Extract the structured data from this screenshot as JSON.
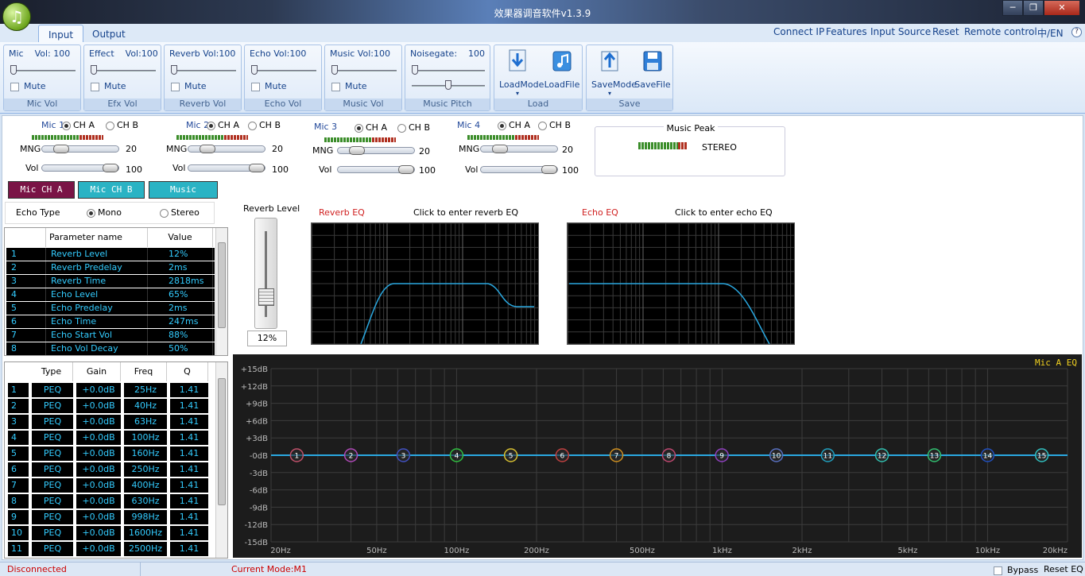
{
  "window": {
    "title": "效果器调音软件v1.3.9"
  },
  "tabs": [
    {
      "label": "Input"
    },
    {
      "label": "Output"
    }
  ],
  "top_links": [
    {
      "label": "Connect IP"
    },
    {
      "label": "Features"
    },
    {
      "label": "Input Source"
    },
    {
      "label": "Reset"
    },
    {
      "label": "Remote control"
    },
    {
      "label": "中/EN"
    }
  ],
  "ribbon": {
    "mic": {
      "label": "Mic    Vol: 100",
      "mute": "Mute",
      "group": "Mic Vol"
    },
    "efx": {
      "label": "Effect    Vol:100",
      "mute": "Mute",
      "group": "Efx Vol"
    },
    "reverb": {
      "label": "Reverb Vol:100",
      "mute": "Mute",
      "group": "Reverb Vol"
    },
    "echo": {
      "label": "Echo Vol:100",
      "mute": "Mute",
      "group": "Echo Vol"
    },
    "music": {
      "label": "Music Vol:100",
      "mute": "Mute",
      "group": "Music Vol"
    },
    "pitch": {
      "label": "Noisegate:    100",
      "group": "Music Pitch"
    },
    "load": {
      "loadmode": "LoadMode",
      "loadfile": "LoadFile",
      "group": "Load"
    },
    "save": {
      "savemode": "SaveMode",
      "savefile": "SaveFile",
      "group": "Save"
    }
  },
  "mics": [
    {
      "name": "Mic 1",
      "cha": "CH A",
      "chb": "CH B",
      "mng_label": "MNG",
      "mng": "20",
      "vol_label": "Vol",
      "vol": "100"
    },
    {
      "name": "Mic 2",
      "cha": "CH A",
      "chb": "CH B",
      "mng_label": "MNG",
      "mng": "20",
      "vol_label": "Vol",
      "vol": "100"
    },
    {
      "name": "Mic 3",
      "cha": "CH A",
      "chb": "CH B",
      "mng_label": "MNG",
      "mng": "20",
      "vol_label": "Vol",
      "vol": "100"
    },
    {
      "name": "Mic 4",
      "cha": "CH A",
      "chb": "CH B",
      "mng_label": "MNG",
      "mng": "20",
      "vol_label": "Vol",
      "vol": "100"
    }
  ],
  "music_peak": {
    "title": "Music Peak",
    "mode": "STEREO"
  },
  "channel_buttons": [
    {
      "label": "Mic CH A",
      "color": "#7a1446"
    },
    {
      "label": "Mic CH B",
      "color": "#2ab3c4"
    },
    {
      "label": "Music",
      "color": "#2ab3c4"
    }
  ],
  "echo_type": {
    "label": "Echo Type",
    "mono": "Mono",
    "stereo": "Stereo"
  },
  "param_table": {
    "headers": [
      "Parameter name",
      "Value"
    ],
    "rows": [
      {
        "n": "1",
        "name": "Reverb Level",
        "value": "12%"
      },
      {
        "n": "2",
        "name": "Reverb Predelay",
        "value": "2ms"
      },
      {
        "n": "3",
        "name": "Reverb Time",
        "value": "2818ms"
      },
      {
        "n": "4",
        "name": "Echo Level",
        "value": "65%"
      },
      {
        "n": "5",
        "name": "Echo Predelay",
        "value": "2ms"
      },
      {
        "n": "6",
        "name": "Echo Time",
        "value": "247ms"
      },
      {
        "n": "7",
        "name": "Echo Start Vol",
        "value": "88%"
      },
      {
        "n": "8",
        "name": "Echo Vol Decay",
        "value": "50%"
      }
    ]
  },
  "eq_table": {
    "headers": [
      "Type",
      "Gain",
      "Freq",
      "Q"
    ],
    "rows": [
      {
        "n": "1",
        "type": "PEQ",
        "gain": "+0.0dB",
        "freq": "25Hz",
        "q": "1.41"
      },
      {
        "n": "2",
        "type": "PEQ",
        "gain": "+0.0dB",
        "freq": "40Hz",
        "q": "1.41"
      },
      {
        "n": "3",
        "type": "PEQ",
        "gain": "+0.0dB",
        "freq": "63Hz",
        "q": "1.41"
      },
      {
        "n": "4",
        "type": "PEQ",
        "gain": "+0.0dB",
        "freq": "100Hz",
        "q": "1.41"
      },
      {
        "n": "5",
        "type": "PEQ",
        "gain": "+0.0dB",
        "freq": "160Hz",
        "q": "1.41"
      },
      {
        "n": "6",
        "type": "PEQ",
        "gain": "+0.0dB",
        "freq": "250Hz",
        "q": "1.41"
      },
      {
        "n": "7",
        "type": "PEQ",
        "gain": "+0.0dB",
        "freq": "400Hz",
        "q": "1.41"
      },
      {
        "n": "8",
        "type": "PEQ",
        "gain": "+0.0dB",
        "freq": "630Hz",
        "q": "1.41"
      },
      {
        "n": "9",
        "type": "PEQ",
        "gain": "+0.0dB",
        "freq": "998Hz",
        "q": "1.41"
      },
      {
        "n": "10",
        "type": "PEQ",
        "gain": "+0.0dB",
        "freq": "1600Hz",
        "q": "1.41"
      },
      {
        "n": "11",
        "type": "PEQ",
        "gain": "+0.0dB",
        "freq": "2500Hz",
        "q": "1.41"
      }
    ]
  },
  "reverb_level": {
    "title": "Reverb Level",
    "value": "12%"
  },
  "reverb_eq": {
    "title": "Reverb EQ",
    "hint": "Click to enter reverb EQ"
  },
  "echo_eq": {
    "title": "Echo EQ",
    "hint": "Click to enter echo EQ"
  },
  "main_eq": {
    "title": "Mic A EQ",
    "y_ticks": [
      "+15dB",
      "+12dB",
      "+9dB",
      "+6dB",
      "+3dB",
      "-0dB",
      "-3dB",
      "-6dB",
      "-9dB",
      "-12dB",
      "-15dB"
    ],
    "x_ticks": [
      {
        "label": "20Hz",
        "f": 20
      },
      {
        "label": "50Hz",
        "f": 50
      },
      {
        "label": "100Hz",
        "f": 100
      },
      {
        "label": "200Hz",
        "f": 200
      },
      {
        "label": "500Hz",
        "f": 500
      },
      {
        "label": "1kHz",
        "f": 1000
      },
      {
        "label": "2kHz",
        "f": 2000
      },
      {
        "label": "5kHz",
        "f": 5000
      },
      {
        "label": "10kHz",
        "f": 10000
      },
      {
        "label": "20kHz",
        "f": 20000
      }
    ],
    "bands": [
      {
        "n": "1",
        "f": 25,
        "color": "#c0506a"
      },
      {
        "n": "2",
        "f": 40,
        "color": "#b048b8"
      },
      {
        "n": "3",
        "f": 63,
        "color": "#4050c0"
      },
      {
        "n": "4",
        "f": 100,
        "color": "#30c040"
      },
      {
        "n": "5",
        "f": 160,
        "color": "#d8c030"
      },
      {
        "n": "6",
        "f": 250,
        "color": "#c04040"
      },
      {
        "n": "7",
        "f": 400,
        "color": "#d09020"
      },
      {
        "n": "8",
        "f": 630,
        "color": "#c04870"
      },
      {
        "n": "9",
        "f": 998,
        "color": "#9040c0"
      },
      {
        "n": "10",
        "f": 1600,
        "color": "#5870c0"
      },
      {
        "n": "11",
        "f": 2500,
        "color": "#20a0c0"
      },
      {
        "n": "12",
        "f": 4000,
        "color": "#30c0b0"
      },
      {
        "n": "13",
        "f": 6300,
        "color": "#30c070"
      },
      {
        "n": "14",
        "f": 10000,
        "color": "#2050c0"
      },
      {
        "n": "15",
        "f": 16000,
        "color": "#30c0c0"
      }
    ]
  },
  "status": {
    "connection": "Disconnected",
    "mode": "Current Mode:M1",
    "bypass": "Bypass",
    "reset_eq": "Reset EQ"
  }
}
